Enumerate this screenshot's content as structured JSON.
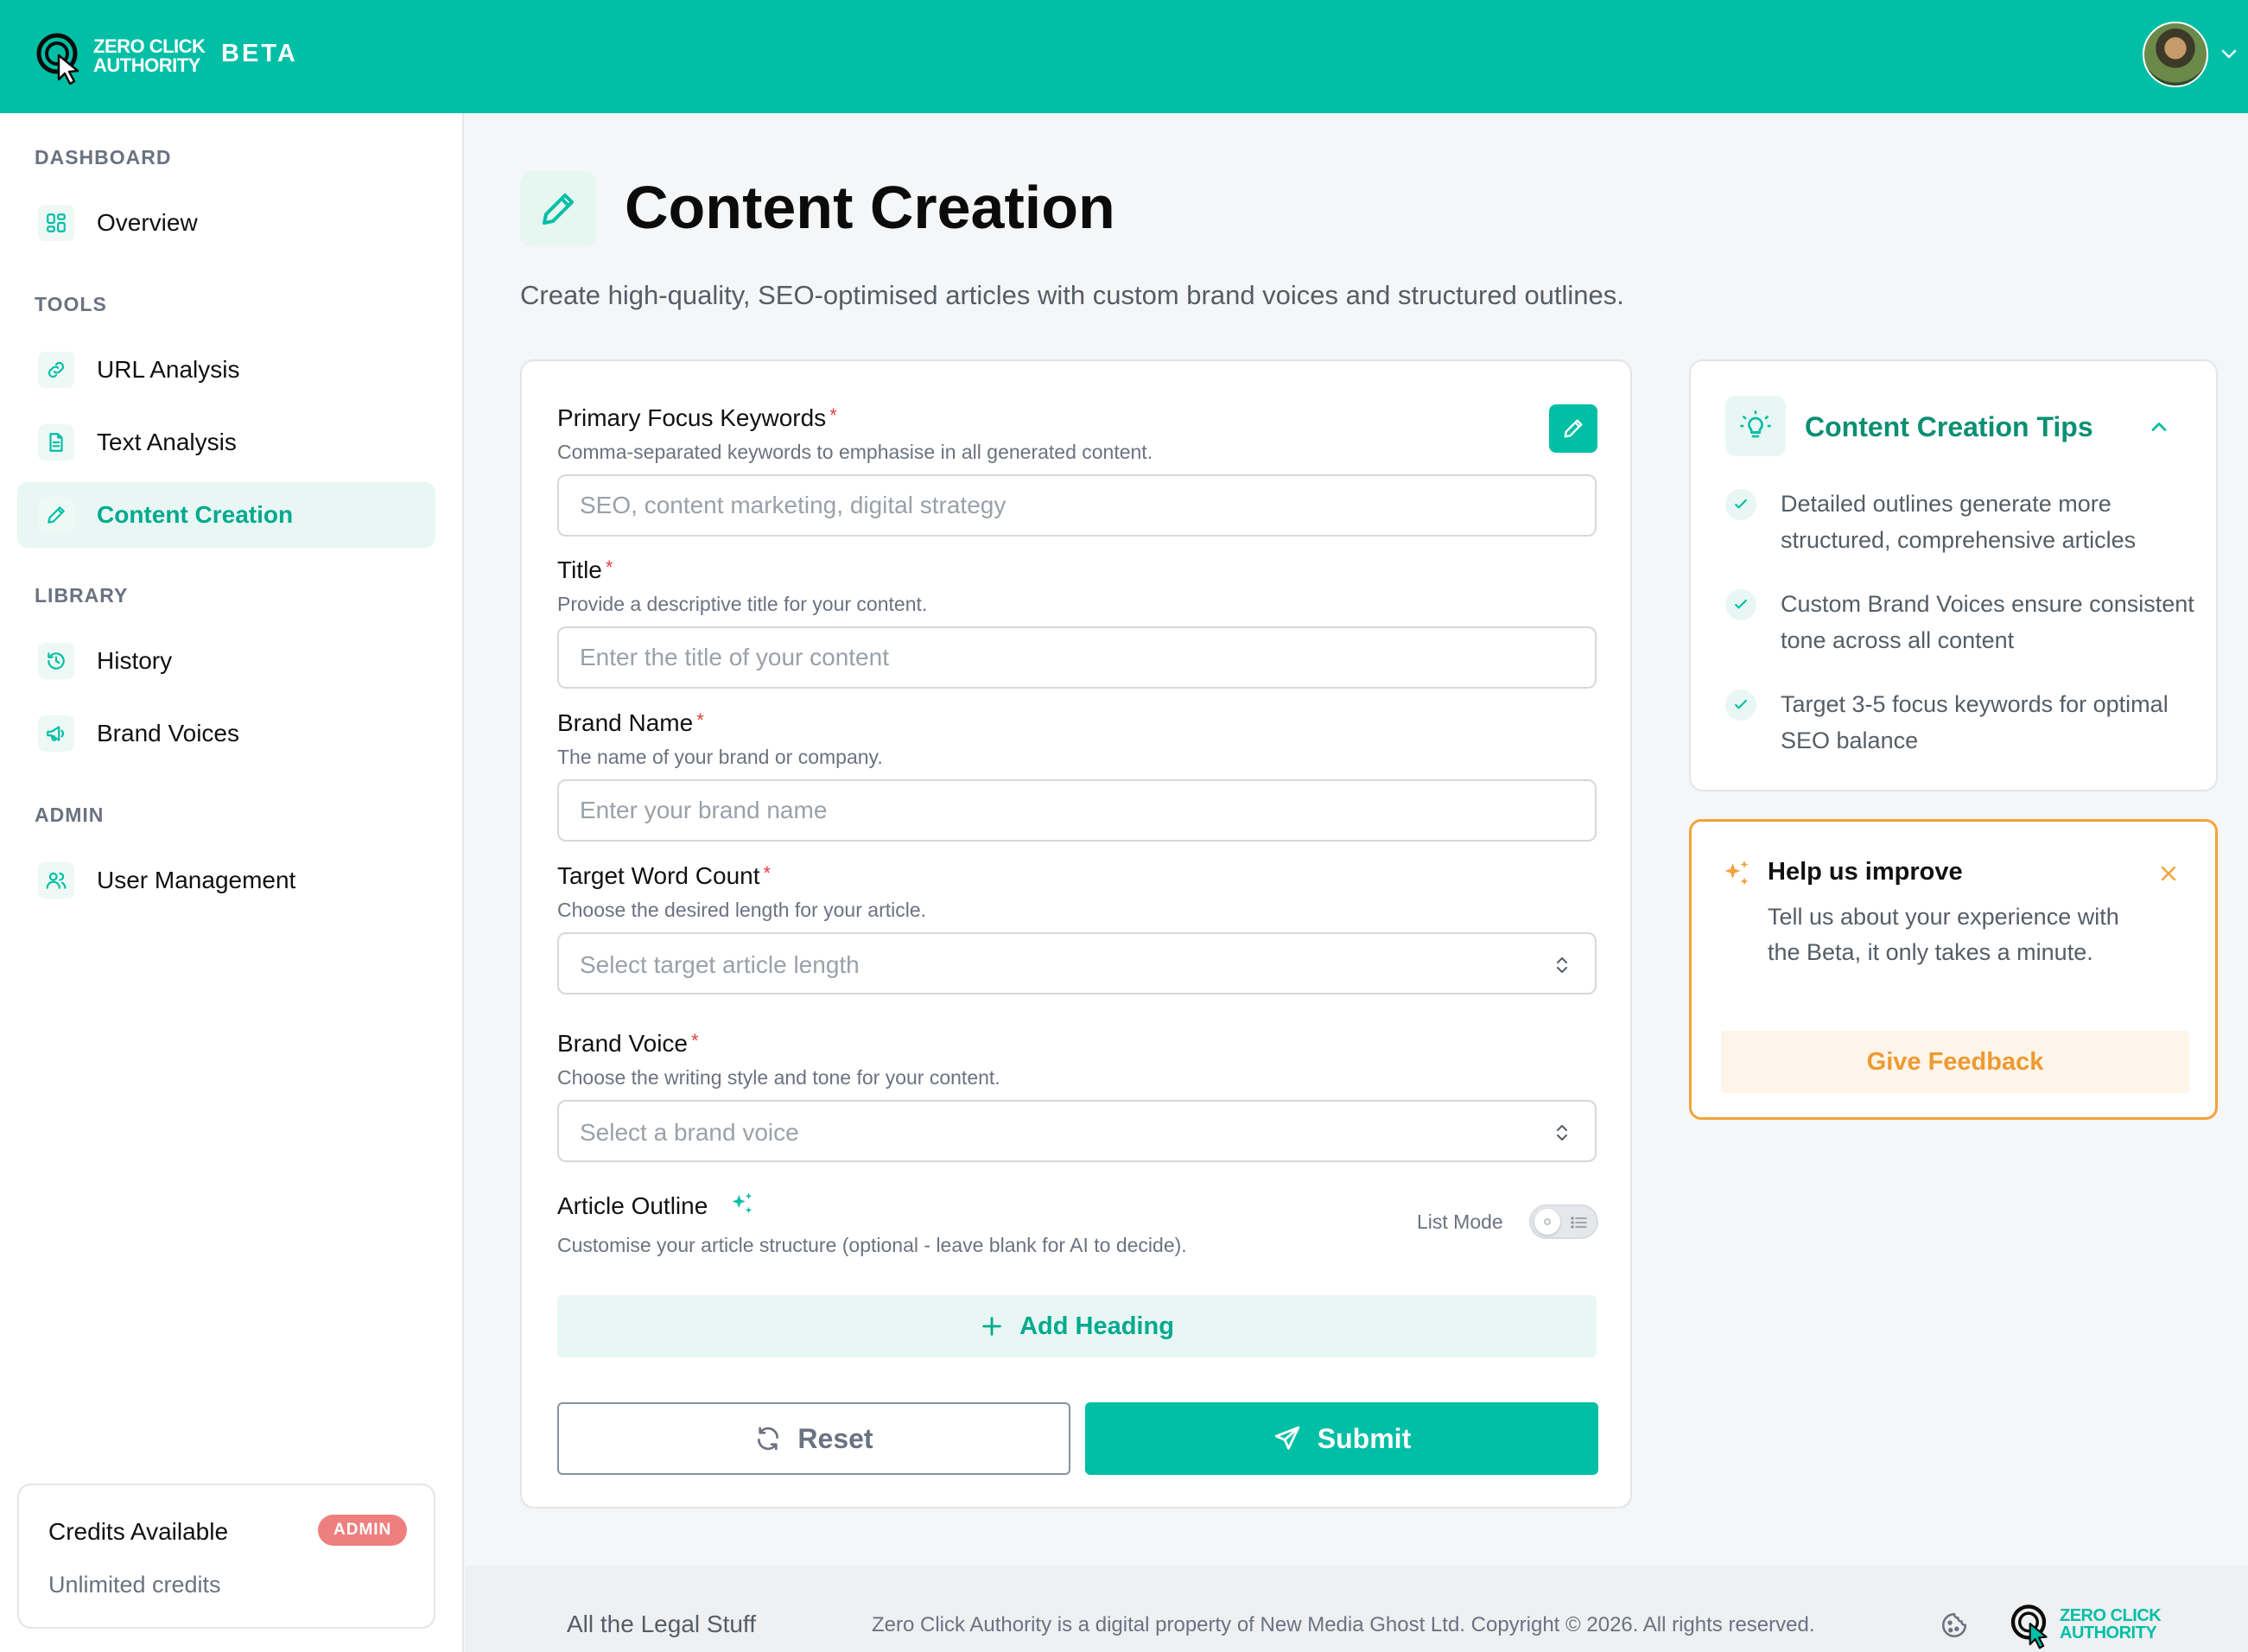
{
  "header": {
    "logo_line1": "ZERO CLICK",
    "logo_line2": "AUTHORITY",
    "beta_label": "BETA"
  },
  "sidebar": {
    "sections": {
      "dashboard": "DASHBOARD",
      "tools": "TOOLS",
      "library": "LIBRARY",
      "admin": "ADMIN"
    },
    "items": {
      "overview": {
        "label": "Overview",
        "icon": "grid-icon"
      },
      "url_analysis": {
        "label": "URL Analysis",
        "icon": "link-icon"
      },
      "text_analysis": {
        "label": "Text Analysis",
        "icon": "document-icon"
      },
      "content_creation": {
        "label": "Content Creation",
        "icon": "pencil-icon",
        "active": true
      },
      "history": {
        "label": "History",
        "icon": "history-icon"
      },
      "brand_voices": {
        "label": "Brand Voices",
        "icon": "megaphone-icon"
      },
      "user_management": {
        "label": "User Management",
        "icon": "users-icon"
      }
    },
    "credits": {
      "title": "Credits Available",
      "badge": "ADMIN",
      "value": "Unlimited credits"
    }
  },
  "page": {
    "title": "Content Creation",
    "subtitle": "Create high-quality, SEO-optimised articles with custom brand voices and structured outlines."
  },
  "form": {
    "keywords": {
      "label": "Primary Focus Keywords",
      "required": "*",
      "help": "Comma-separated keywords to emphasise in all generated content.",
      "placeholder": "SEO, content marketing, digital strategy",
      "value": ""
    },
    "title": {
      "label": "Title",
      "required": "*",
      "help": "Provide a descriptive title for your content.",
      "placeholder": "Enter the title of your content",
      "value": ""
    },
    "brand_name": {
      "label": "Brand Name",
      "required": "*",
      "help": "The name of your brand or company.",
      "placeholder": "Enter your brand name",
      "value": ""
    },
    "word_count": {
      "label": "Target Word Count",
      "required": "*",
      "help": "Choose the desired length for your article.",
      "placeholder": "Select target article length"
    },
    "brand_voice": {
      "label": "Brand Voice",
      "required": "*",
      "help": "Choose the writing style and tone for your content.",
      "placeholder": "Select a brand voice"
    },
    "outline": {
      "label": "Article Outline",
      "help": "Customise your article structure (optional - leave blank for AI to decide).",
      "list_mode_label": "List Mode",
      "list_mode_on": false,
      "add_heading_label": "Add Heading"
    },
    "reset_label": "Reset",
    "submit_label": "Submit"
  },
  "tips": {
    "title": "Content Creation Tips",
    "items": [
      "Detailed outlines generate more structured, comprehensive articles",
      "Custom Brand Voices ensure consistent tone across all content",
      "Target 3-5 focus keywords for optimal SEO balance"
    ]
  },
  "feedback": {
    "title": "Help us improve",
    "text": "Tell us about your experience with the Beta, it only takes a minute.",
    "button": "Give Feedback"
  },
  "footer": {
    "legal": "All the Legal Stuff",
    "copyright": "Zero Click Authority is a digital property of New Media Ghost Ltd. Copyright © 2026. All rights reserved.",
    "logo_line1": "ZERO CLICK",
    "logo_line2": "AUTHORITY"
  },
  "colors": {
    "brand": "#00bfa5",
    "brand_dark": "#0a8f72",
    "required": "#e53e3e",
    "feedback_accent": "#f2a33a",
    "admin_badge": "#ef7f7f"
  }
}
